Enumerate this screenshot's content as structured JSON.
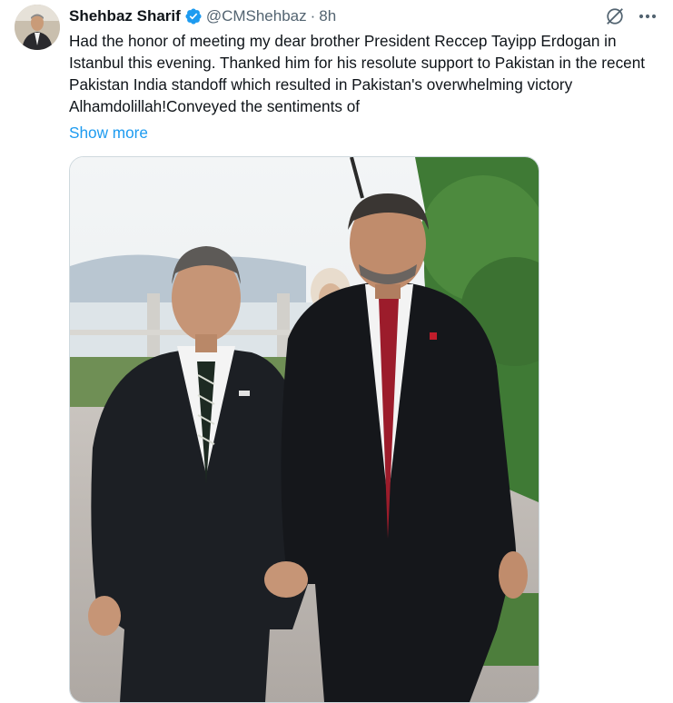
{
  "tweet": {
    "author_name": "Shehbaz Sharif",
    "handle": "@CMShehbaz",
    "separator": "·",
    "time": "8h",
    "text": "Had the honor of meeting my dear brother President Reccep Tayipp Erdogan in Istanbul this evening. Thanked him for his resolute support to Pakistan in the recent Pakistan India standoff which resulted in Pakistan's overwhelming victory Alhamdolillah!Conveyed the sentiments of",
    "show_more_label": "Show more"
  },
  "icons": {
    "verified": "verified-badge-icon",
    "grok": "grok-icon",
    "more": "more-options-icon"
  },
  "colors": {
    "link": "#1d9bf0",
    "verified": "#1d9bf0",
    "secondary_text": "#536471"
  }
}
